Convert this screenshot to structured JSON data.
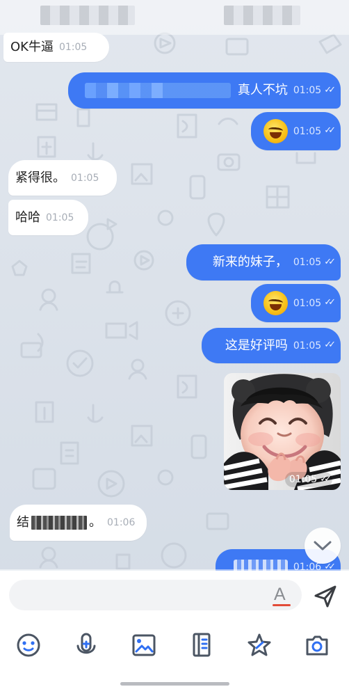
{
  "messages": {
    "m1": {
      "text": "OK牛逼",
      "time": "01:05"
    },
    "m2": {
      "text": "真人不坑",
      "time": "01:05"
    },
    "m3": {
      "emoji": "laughing-face-emoji",
      "time": "01:05"
    },
    "m4": {
      "text": "紧得很。",
      "time": "01:05"
    },
    "m5": {
      "text": "哈哈",
      "time": "01:05"
    },
    "m6": {
      "text": "新来的妹子，",
      "time": "01:05"
    },
    "m7": {
      "emoji": "laughing-face-emoji",
      "time": "01:05"
    },
    "m8": {
      "text": "这是好评吗",
      "time": "01:05"
    },
    "photo": {
      "time": "01:05"
    },
    "m9": {
      "prefix": "结",
      "suffix": "。",
      "time": "01:06"
    },
    "m10": {
      "time": "01:06"
    }
  },
  "composer": {
    "font_icon_label": "A"
  },
  "icons": {
    "scroll_down": "chevron-down-icon",
    "send": "paper-plane-icon",
    "tools": [
      "emoji-icon",
      "voice-icon",
      "image-icon",
      "note-icon",
      "star-icon",
      "camera-icon"
    ]
  },
  "colors": {
    "chat_background": "#d6dde6",
    "outgoing_bubble": "#3e79f4",
    "incoming_bubble": "#ffffff",
    "icon_blue": "#2f6ff2",
    "icon_dark": "#4b5563"
  }
}
